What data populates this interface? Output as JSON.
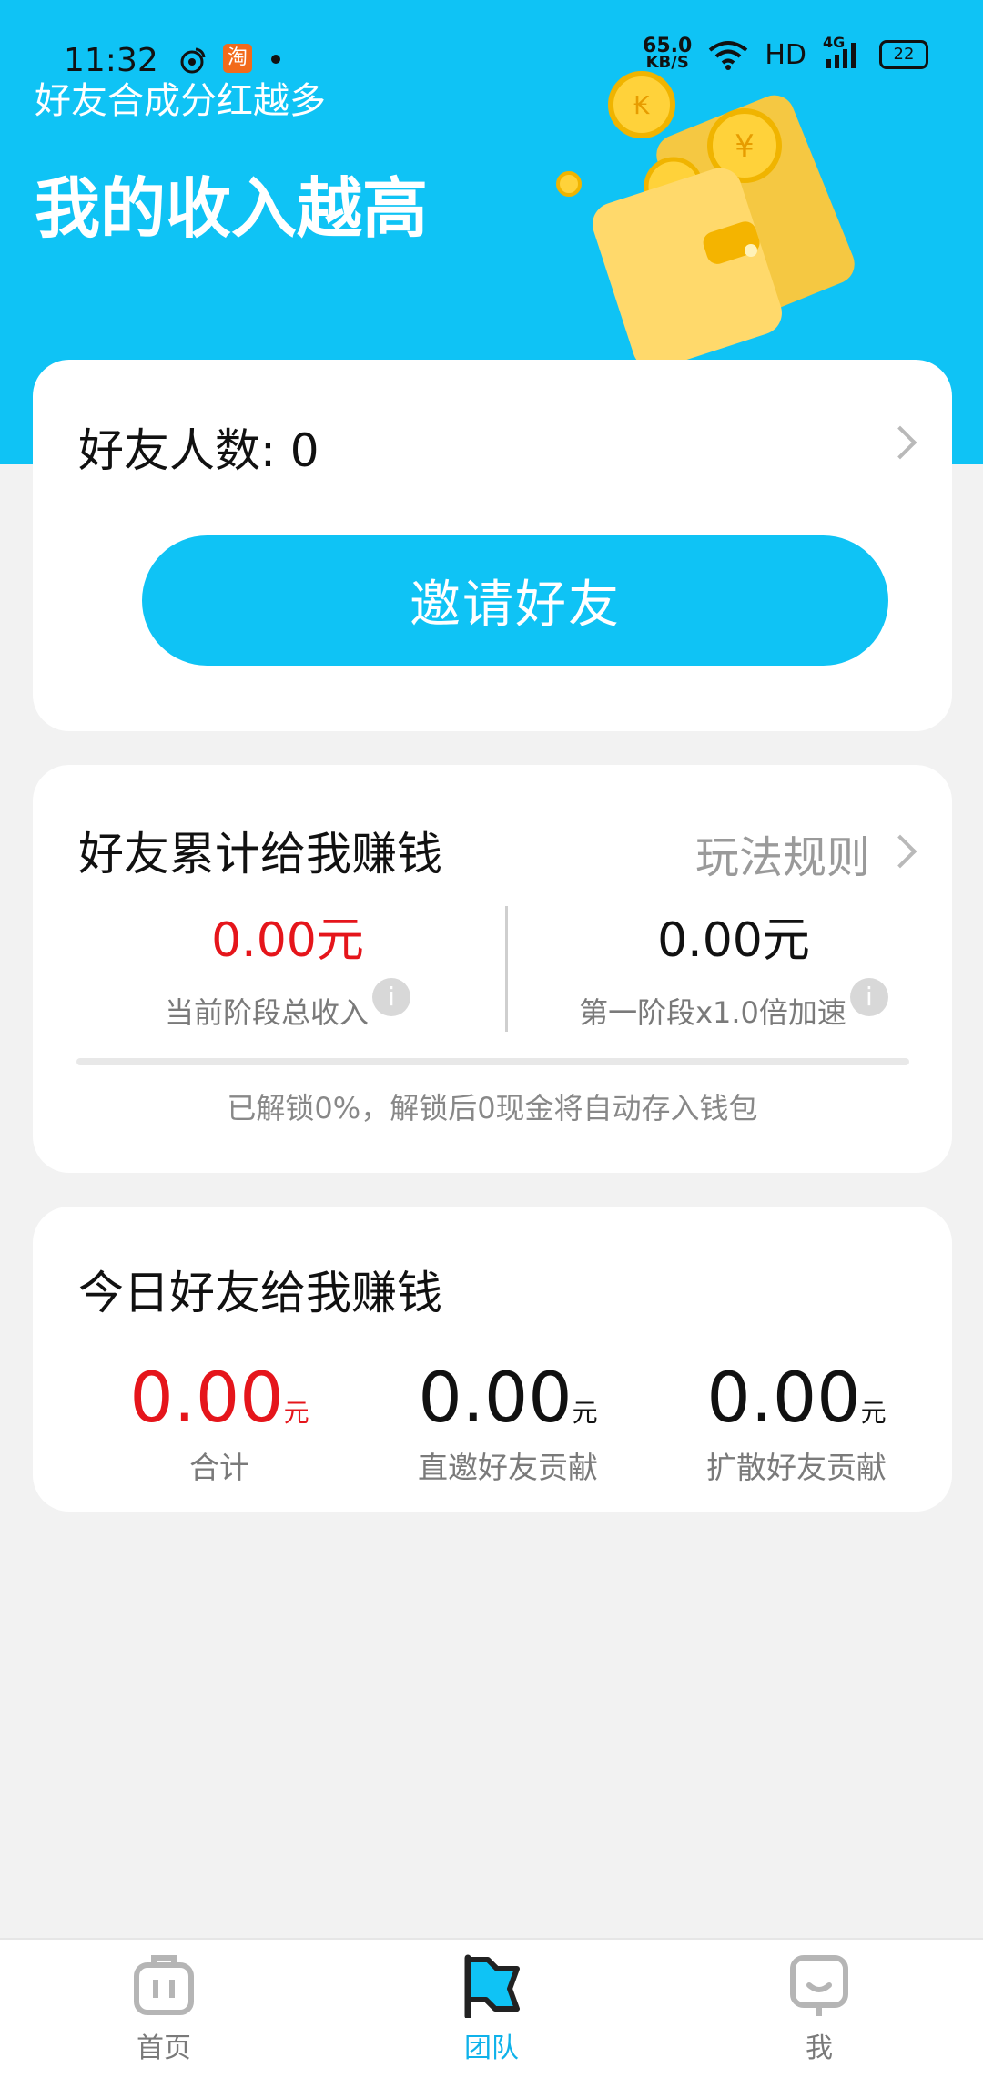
{
  "status_bar": {
    "time": "11:32",
    "net_speed_value": "65.0",
    "net_speed_unit": "KB/S",
    "hd": "HD",
    "network": "4G",
    "battery": "22",
    "taobao_glyph": "淘",
    "icons": [
      "weibo-icon",
      "taobao-icon",
      "dot-icon",
      "wifi-icon",
      "signal-icon",
      "battery-icon"
    ]
  },
  "banner": {
    "subtitle": "好友合成分红越多",
    "title": "我的收入越高",
    "illustration": "wallet-with-coins"
  },
  "friends_card": {
    "label": "好友人数:",
    "count": "0",
    "invite_button": "邀请好友"
  },
  "cumulative_card": {
    "title": "好友累计给我赚钱",
    "rules_link": "玩法规则",
    "current_total_value": "0.00元",
    "current_total_label": "当前阶段总收入",
    "stage_one_value": "0.00元",
    "stage_one_label": "第一阶段x1.0倍加速",
    "unlock_progress": 0,
    "unlock_note": "已解锁0%，解锁后0现金将自动存入钱包"
  },
  "today_card": {
    "title": "今日好友给我赚钱",
    "unit": "元",
    "items": [
      {
        "value": "0.00",
        "label": "合计"
      },
      {
        "value": "0.00",
        "label": "直邀好友贡献"
      },
      {
        "value": "0.00",
        "label": "扩散好友贡献"
      }
    ]
  },
  "bottom_nav": {
    "items": [
      {
        "label": "首页",
        "icon": "home-icon"
      },
      {
        "label": "团队",
        "icon": "team-flag-icon"
      },
      {
        "label": "我",
        "icon": "profile-icon"
      }
    ],
    "active": "团队"
  },
  "colors": {
    "accent": "#0fc3f5",
    "highlight_red": "#e5151b",
    "background": "#f2f2f2"
  }
}
